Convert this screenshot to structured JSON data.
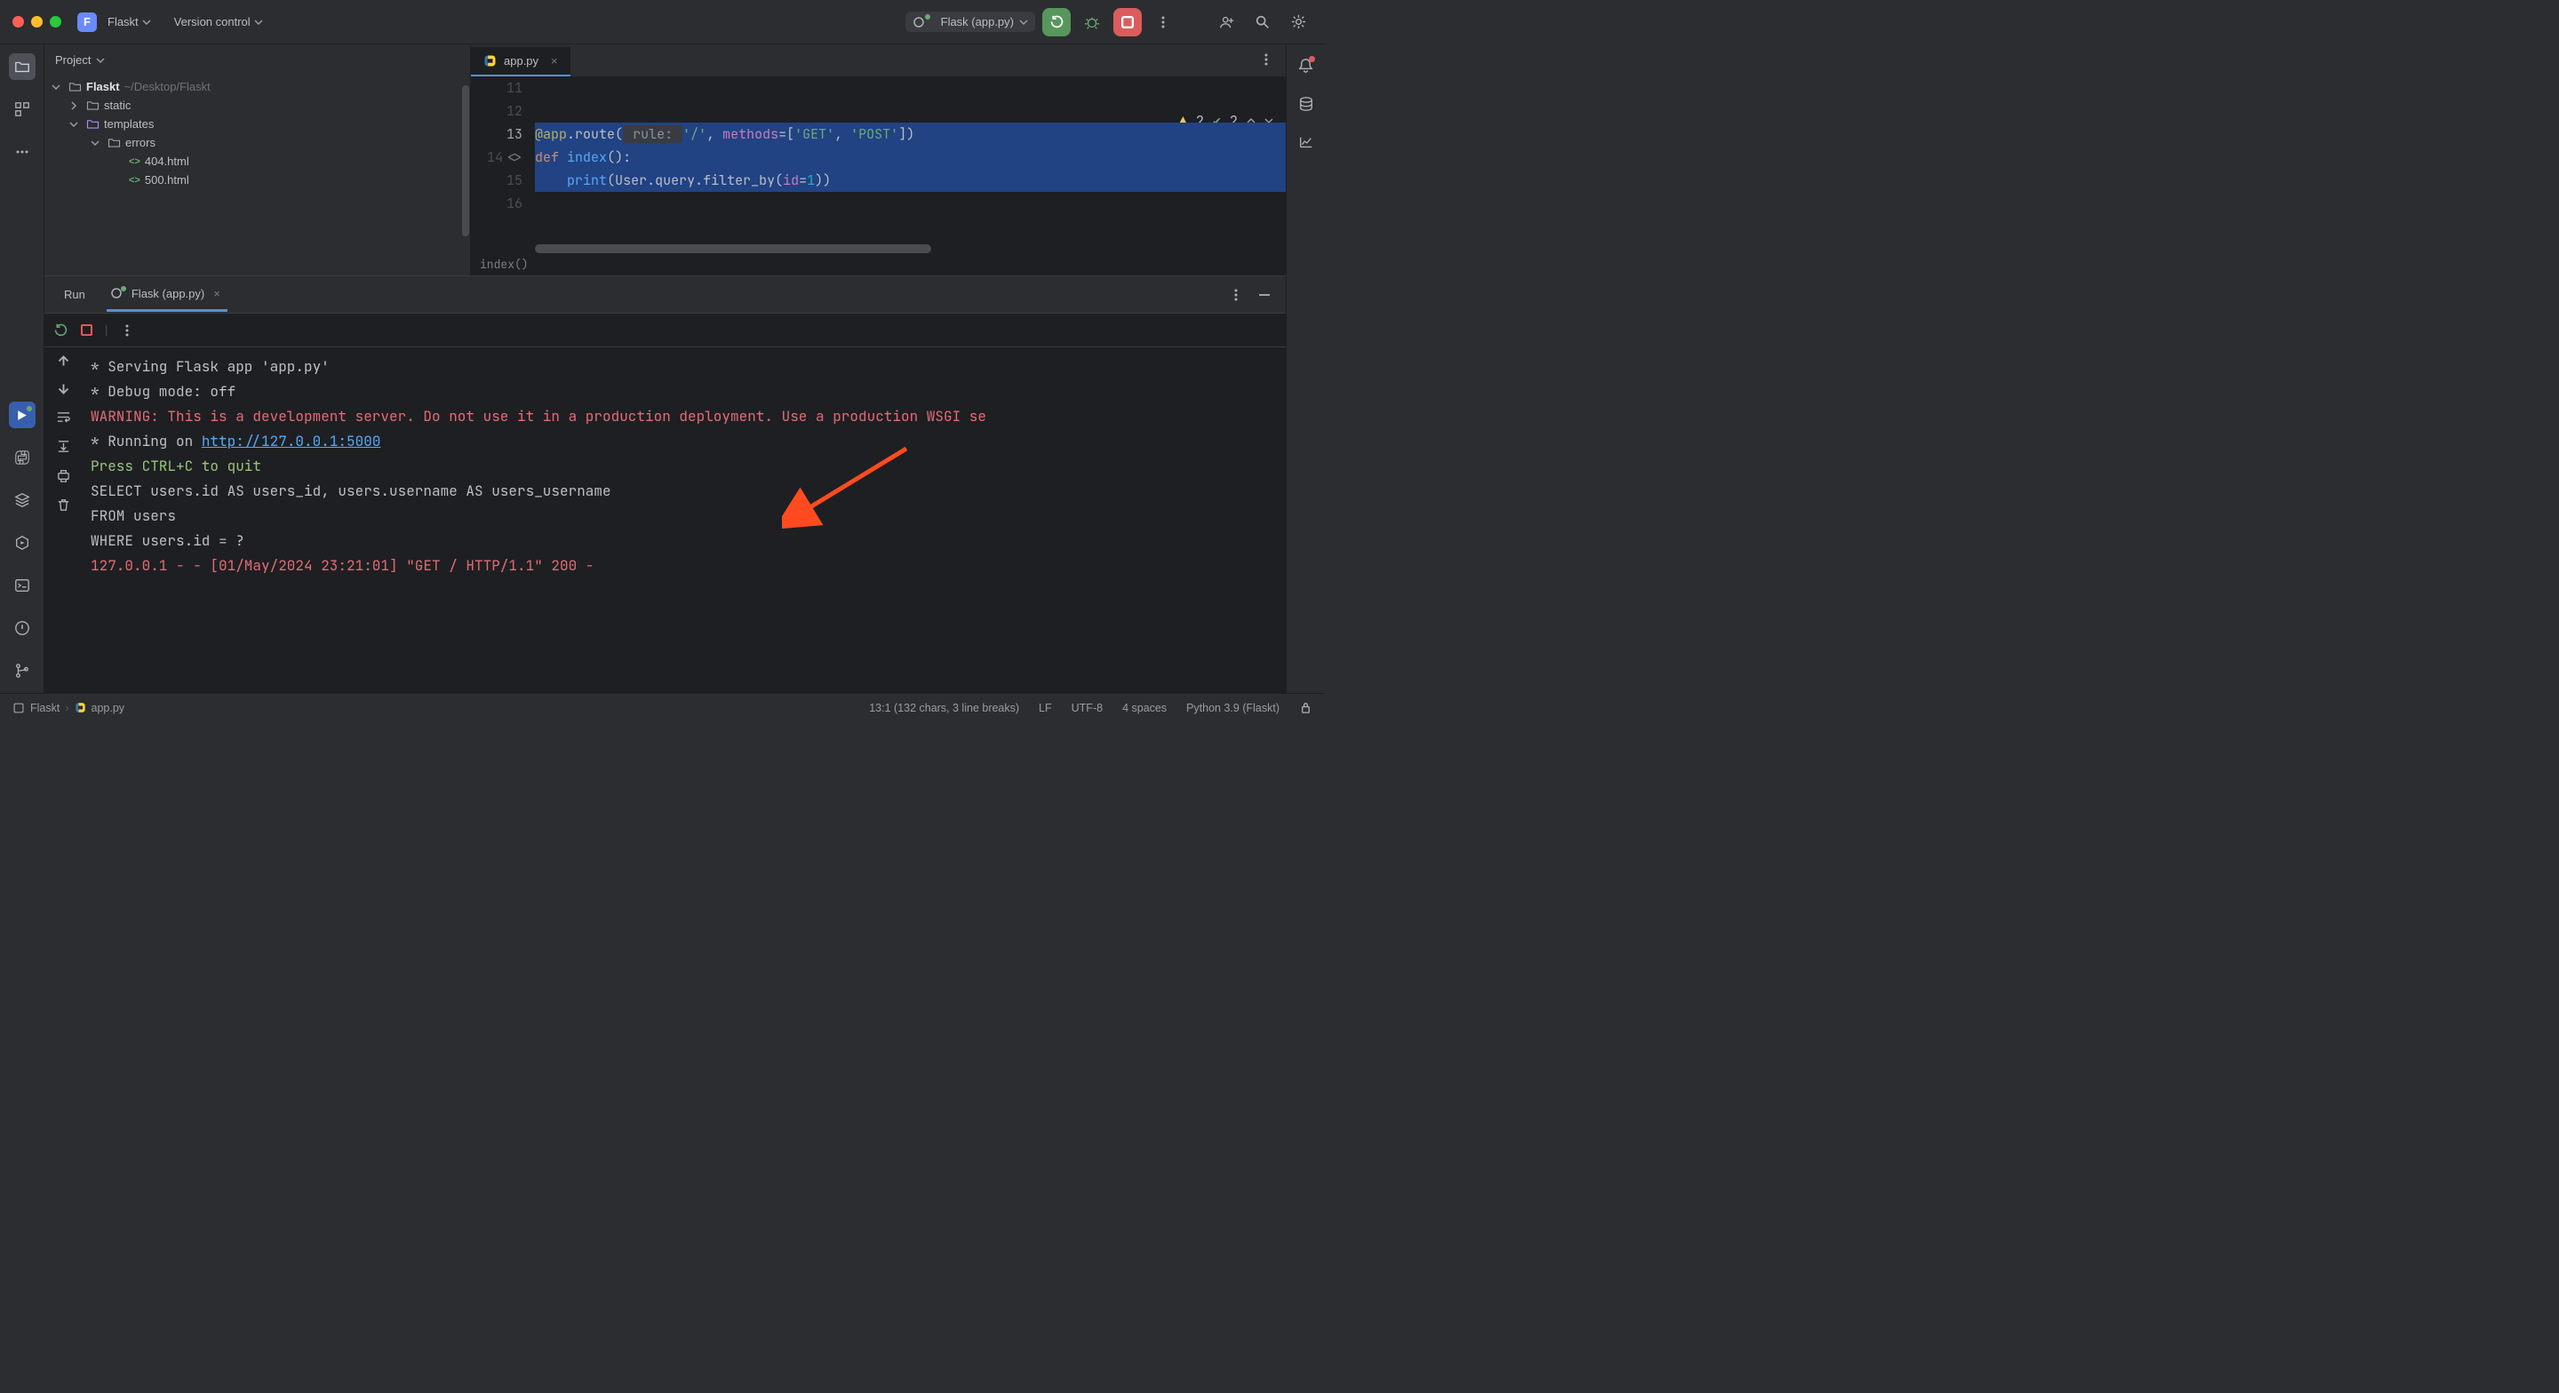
{
  "titlebar": {
    "project_badge": "F",
    "project_name": "Flaskt",
    "vcs_label": "Version control"
  },
  "run_config": {
    "name": "Flask (app.py)"
  },
  "project_tool": {
    "title": "Project"
  },
  "tree": {
    "root": {
      "name": "Flaskt",
      "path": "~/Desktop/Flaskt"
    },
    "static": "static",
    "templates": "templates",
    "errors": "errors",
    "f404": "404.html",
    "f500": "500.html"
  },
  "editor": {
    "tab": "app.py",
    "breadcrumb": "index()",
    "warn_count": "2",
    "check_count": "2",
    "lines": {
      "l11": "11",
      "l12": "12",
      "l13": "13",
      "l14": "14",
      "l15": "15",
      "l16": "16"
    },
    "code13_at": "@app",
    "code13_route": ".route(",
    "code13_rule": " rule: ",
    "code13_rule_v": "'/'",
    "code13_c1": ", ",
    "code13_methods": "methods",
    "code13_eq": "=[",
    "code13_get": "'GET'",
    "code13_c2": ", ",
    "code13_post": "'POST'",
    "code13_end": "])",
    "code14_def": "def ",
    "code14_name": "index",
    "code14_p": "():",
    "code15_indent": "    ",
    "code15_print": "print",
    "code15_p1": "(User.query.filter_by(",
    "code15_id": "id",
    "code15_eq": "=",
    "code15_one": "1",
    "code15_end": "))"
  },
  "run_panel": {
    "tab_run": "Run",
    "tab_active": "Flask (app.py)",
    "console": {
      "l1": " * Serving Flask app 'app.py'",
      "l2": " * Debug mode: off",
      "l3": "WARNING: This is a development server. Do not use it in a production deployment. Use a production WSGI se",
      "l4a": " * Running on ",
      "l4b": "http://127.0.0.1:5000",
      "l5": "Press CTRL+C to quit",
      "l6": "SELECT users.id AS users_id, users.username AS users_username",
      "l7": "FROM users",
      "l8": "WHERE users.id = ?",
      "l9": "127.0.0.1 - - [01/May/2024 23:21:01] \"GET / HTTP/1.1\" 200 -"
    }
  },
  "status": {
    "bc1": "Flaskt",
    "bc2": "app.py",
    "pos": "13:1 (132 chars, 3 line breaks)",
    "le": "LF",
    "enc": "UTF-8",
    "indent": "4 spaces",
    "interp": "Python 3.9 (Flaskt)"
  }
}
